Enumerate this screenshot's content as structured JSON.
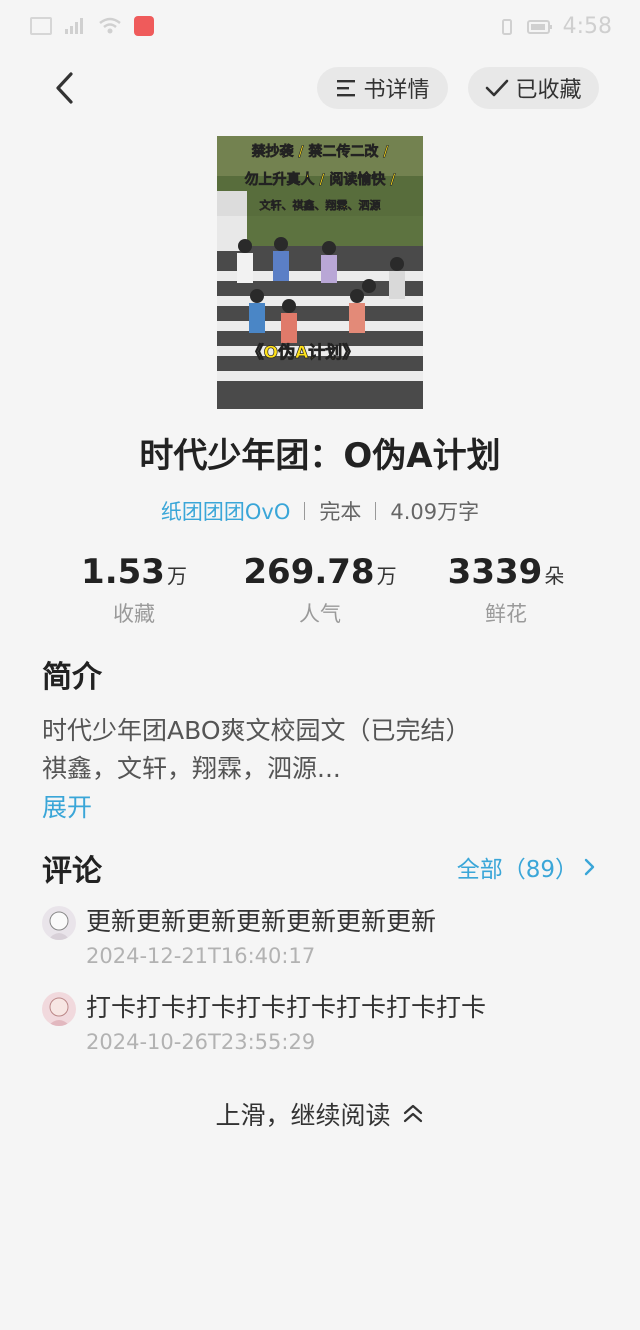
{
  "status_bar": {
    "time": "4:58"
  },
  "header": {
    "details_label": "书详情",
    "favorited_label": "已收藏"
  },
  "cover": {
    "line1": "禁抄袭 / 禁二传二改 /",
    "line2": "勿上升真人 / 阅读愉快 /",
    "line3": "文轩、祺鑫、翔霖、泗源",
    "cover_title": "《O伪A计划》"
  },
  "book": {
    "title": "时代少年团：O伪A计划",
    "author": "纸团团团OvO",
    "status": "完本",
    "word_count": "4.09万字"
  },
  "stats": [
    {
      "value": "1.53",
      "unit": "万",
      "label": "收藏"
    },
    {
      "value": "269.78",
      "unit": "万",
      "label": "人气"
    },
    {
      "value": "3339",
      "unit": "朵",
      "label": "鲜花"
    }
  ],
  "intro": {
    "heading": "简介",
    "line1": "时代少年团ABO爽文校园文（已完结）",
    "line2": "祺鑫，文轩，翔霖，泗源...",
    "expand_label": "展开"
  },
  "comments": {
    "heading": "评论",
    "all_label": "全部（89）",
    "items": [
      {
        "text": "更新更新更新更新更新更新更新",
        "time": "2024-12-21T16:40:17"
      },
      {
        "text": "打卡打卡打卡打卡打卡打卡打卡打卡",
        "time": "2024-10-26T23:55:29"
      }
    ]
  },
  "footer": {
    "continue_label": "上滑，继续阅读"
  },
  "colors": {
    "accent": "#3aa6d8",
    "background": "#f5f5f5"
  }
}
